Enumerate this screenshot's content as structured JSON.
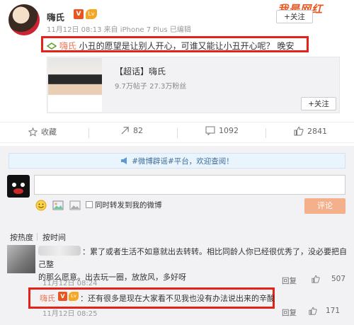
{
  "watermark": "我是网红",
  "post": {
    "author": "嗨氏",
    "v_badge": "V",
    "level_badge": "Lv",
    "meta": "11月12日 08:13 来自 iPhone 7 Plus 已编辑",
    "follow_label": "+关注",
    "text_prefix": "嗨氏",
    "text": "小丑的愿望是让别人开心，可谁又能让小丑开心呢？ 晚安"
  },
  "card": {
    "title": "【超话】嗨氏",
    "stats": "9.7万帖子 27.3万粉丝",
    "follow_label": "+关注"
  },
  "actions": {
    "favorite": "收藏",
    "repost": "82",
    "comment": "1092",
    "like": "2841"
  },
  "notice": {
    "text": "#微博辟谣#平台，欢迎查阅！"
  },
  "comment_box": {
    "checkbox_label": "同时转发到我的微博",
    "submit_label": "评论"
  },
  "sort": {
    "hot": "按热度",
    "time": "按时间"
  },
  "comment1": {
    "text_line1": "：累了或者生活不如意就出去转转。相比同龄人你已经很优秀了，没必要把自己整",
    "text_line2": "的那么愿意。出去玩一圈，放放风，多好呀",
    "meta": "11月12日 08:24",
    "report": "回复",
    "likes": "507"
  },
  "reply": {
    "name": "嗨氏",
    "v_badge": "V",
    "level_badge": "Lv",
    "text": "：还有很多是现在大家看不见我也没有办法说出来的辛酸",
    "meta": "11月12日 08:25",
    "report": "回复",
    "likes": "171"
  },
  "colors": {
    "accent": "#eb7350",
    "highlight_box": "#e2231a",
    "submit_disabled": "#f3b08a"
  }
}
